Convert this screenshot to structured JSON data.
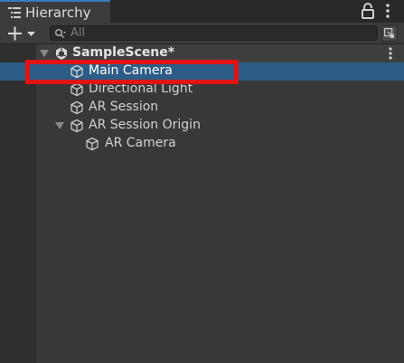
{
  "window": {
    "tab_label": "Hierarchy"
  },
  "toolbar": {
    "search_placeholder": "All"
  },
  "hierarchy": {
    "scene_name": "SampleScene*",
    "items": [
      {
        "label": "Main Camera",
        "selected": true
      },
      {
        "label": "Directional Light",
        "selected": false
      },
      {
        "label": "AR Session",
        "selected": false
      },
      {
        "label": "AR Session Origin",
        "selected": false,
        "expanded": true
      },
      {
        "label": "AR Camera",
        "selected": false
      }
    ]
  },
  "icons": {
    "tab": "hierarchy-list-icon",
    "lock": "lock-icon",
    "menu": "kebab-menu-icon",
    "add": "plus-icon",
    "search": "search-icon",
    "scene": "unity-scene-icon",
    "gameobject": "cube-icon"
  },
  "colors": {
    "panel_bg": "#383838",
    "selection": "#2c5d87",
    "tab_accent": "#3a79bb",
    "annotation": "#e01414"
  }
}
